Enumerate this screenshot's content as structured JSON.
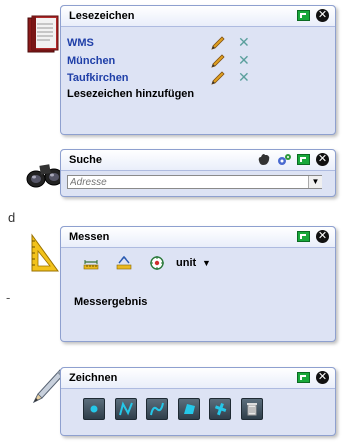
{
  "colors": {
    "accent_blue": "#1f3fa8",
    "panel_bg": "#dde3f4",
    "border": "#8ea0cf",
    "minimize_green": "#18a83a"
  },
  "bookmarks": {
    "title": "Lesezeichen",
    "items": [
      {
        "label": "WMS"
      },
      {
        "label": "München"
      },
      {
        "label": "Taufkirchen"
      }
    ],
    "add_label": "Lesezeichen hinzufügen",
    "icons": [
      "book-icon",
      "pencil-icon",
      "x-icon",
      "minimize-icon",
      "close-icon"
    ]
  },
  "search": {
    "title": "Suche",
    "placeholder": "Adresse",
    "icons": [
      "binoculars-icon",
      "hand-icon",
      "settings-icon",
      "minimize-icon",
      "close-icon"
    ]
  },
  "measure": {
    "title": "Messen",
    "unit_label": "unit",
    "result_label": "Messergebnis",
    "icons": [
      "ruler-triangle-icon",
      "measure-distance-icon",
      "measure-area-icon",
      "measure-point-icon"
    ]
  },
  "draw": {
    "title": "Zeichnen",
    "tools": [
      "point-tool-icon",
      "line-tool-icon",
      "curve-tool-icon",
      "polygon-tool-icon",
      "edit-tool-icon",
      "trash-icon"
    ]
  },
  "background_text": {
    "left_letter": "d"
  }
}
